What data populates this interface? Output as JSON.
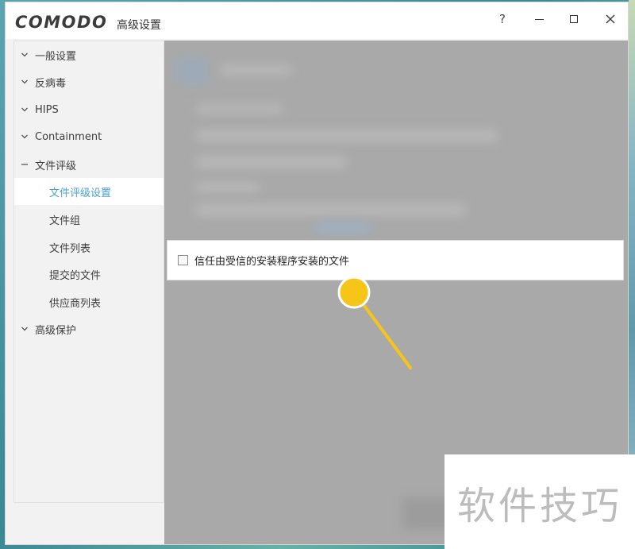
{
  "window": {
    "logo_text": "COMODO",
    "title": "高级设置",
    "buttons": {
      "help": "?"
    }
  },
  "sidebar": {
    "sections": [
      {
        "label": "一般设置",
        "state": "collapsed"
      },
      {
        "label": "反病毒",
        "state": "collapsed"
      },
      {
        "label": "HIPS",
        "state": "collapsed"
      },
      {
        "label": "Containment",
        "state": "collapsed"
      },
      {
        "label": "文件评级",
        "state": "expanded"
      },
      {
        "label": "高级保护",
        "state": "collapsed"
      }
    ],
    "file_rating_items": [
      {
        "label": "文件评级设置",
        "active": true
      },
      {
        "label": "文件组",
        "active": false
      },
      {
        "label": "文件列表",
        "active": false
      },
      {
        "label": "提交的文件",
        "active": false
      },
      {
        "label": "供应商列表",
        "active": false
      }
    ]
  },
  "main": {
    "option": {
      "label": "信任由受信的安装程序安装的文件",
      "checked": false
    }
  },
  "watermark": "软件技巧",
  "colors": {
    "accent": "#4a9fd0",
    "highlight": "#f5c518"
  }
}
